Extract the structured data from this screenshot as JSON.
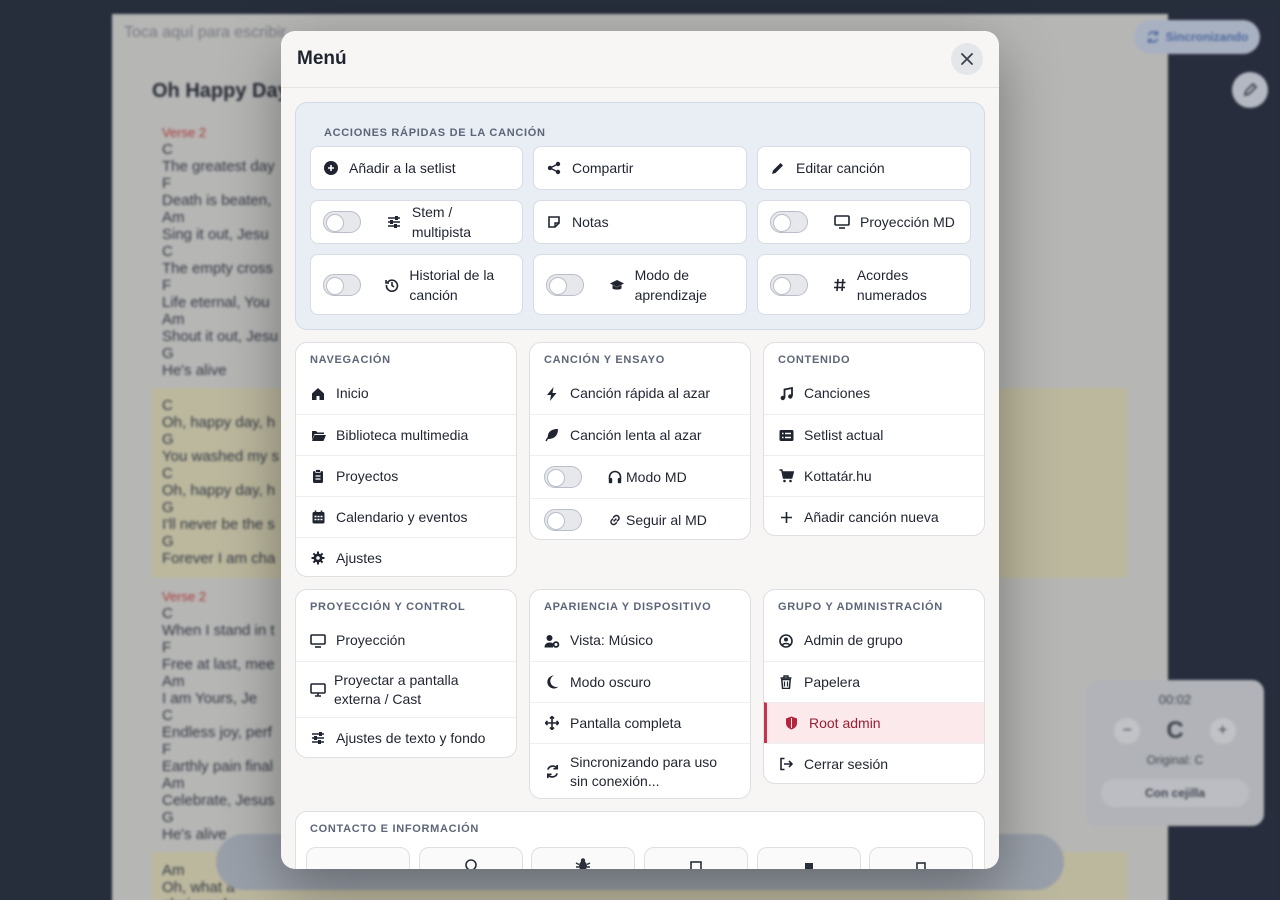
{
  "background": {
    "search_placeholder": "Toca aquí para escribir...",
    "song_title": "Oh Happy Day",
    "sync_badge": "Sincronizando",
    "lyrics_block_1": [
      "Verse 2",
      "C",
      "The greatest day",
      "F",
      "Death is beaten,",
      "Am",
      "Sing it out, Jesu",
      "C",
      "The empty cross",
      "F",
      "Life eternal, You",
      "Am",
      "Shout it out, Jesu",
      "G",
      "He's alive"
    ],
    "lyrics_block_2": [
      "C",
      "Oh, happy day, h",
      "G",
      "You washed my s",
      "C",
      "Oh, happy day, h",
      "G",
      "I'll never be the s",
      "G",
      "Forever I am cha"
    ],
    "lyrics_block_3": [
      "Verse 2",
      "C",
      "When I stand in t",
      "F",
      "Free at last, mee",
      "Am",
      "I am Yours, Je",
      "C",
      "Endless joy, perf",
      "F",
      "Earthly pain final",
      "Am",
      "Celebrate, Jesus",
      "G",
      "He's alive"
    ],
    "lyrics_block_4": [
      "Am",
      "Oh, what a glorious day"
    ],
    "transpose": {
      "timer": "00:02",
      "key": "C",
      "original_label": "Original: C",
      "capo_label": "Con cejilla"
    }
  },
  "modal": {
    "title": "Menú",
    "quick_actions": {
      "title": "ACCIONES RÁPIDAS DE LA CANCIÓN",
      "add_setlist": "Añadir a la setlist",
      "share": "Compartir",
      "edit_song": "Editar canción",
      "stem": "Stem / multipista",
      "notes": "Notas",
      "projection_md": "Proyección MD",
      "history": "Historial de la canción",
      "learning": "Modo de aprendizaje",
      "numbered_chords": "Acordes numerados"
    },
    "navigation": {
      "title": "NAVEGACIÓN",
      "items": [
        "Inicio",
        "Biblioteca multimedia",
        "Proyectos",
        "Calendario y eventos",
        "Ajustes"
      ]
    },
    "rehearsal": {
      "title": "CANCIÓN Y ENSAYO",
      "items": [
        "Canción rápida al azar",
        "Canción lenta al azar",
        "Modo MD",
        "Seguir al MD"
      ]
    },
    "content": {
      "title": "CONTENIDO",
      "items": [
        "Canciones",
        "Setlist actual",
        "Kottatár.hu",
        "Añadir canción nueva"
      ]
    },
    "projection": {
      "title": "PROYECCIÓN Y CONTROL",
      "items": [
        "Proyección",
        "Proyectar a pantalla externa / Cast",
        "Ajustes de texto y fondo"
      ]
    },
    "appearance": {
      "title": "APARIENCIA Y DISPOSITIVO",
      "items": [
        "Vista: Músico",
        "Modo oscuro",
        "Pantalla completa",
        "Sincronizando para uso sin conexión..."
      ]
    },
    "group_admin": {
      "title": "GRUPO Y ADMINISTRACIÓN",
      "items": [
        "Admin de grupo",
        "Papelera",
        "Root admin",
        "Cerrar sesión"
      ]
    },
    "contact": {
      "title": "CONTACTO E INFORMACIÓN"
    }
  }
}
